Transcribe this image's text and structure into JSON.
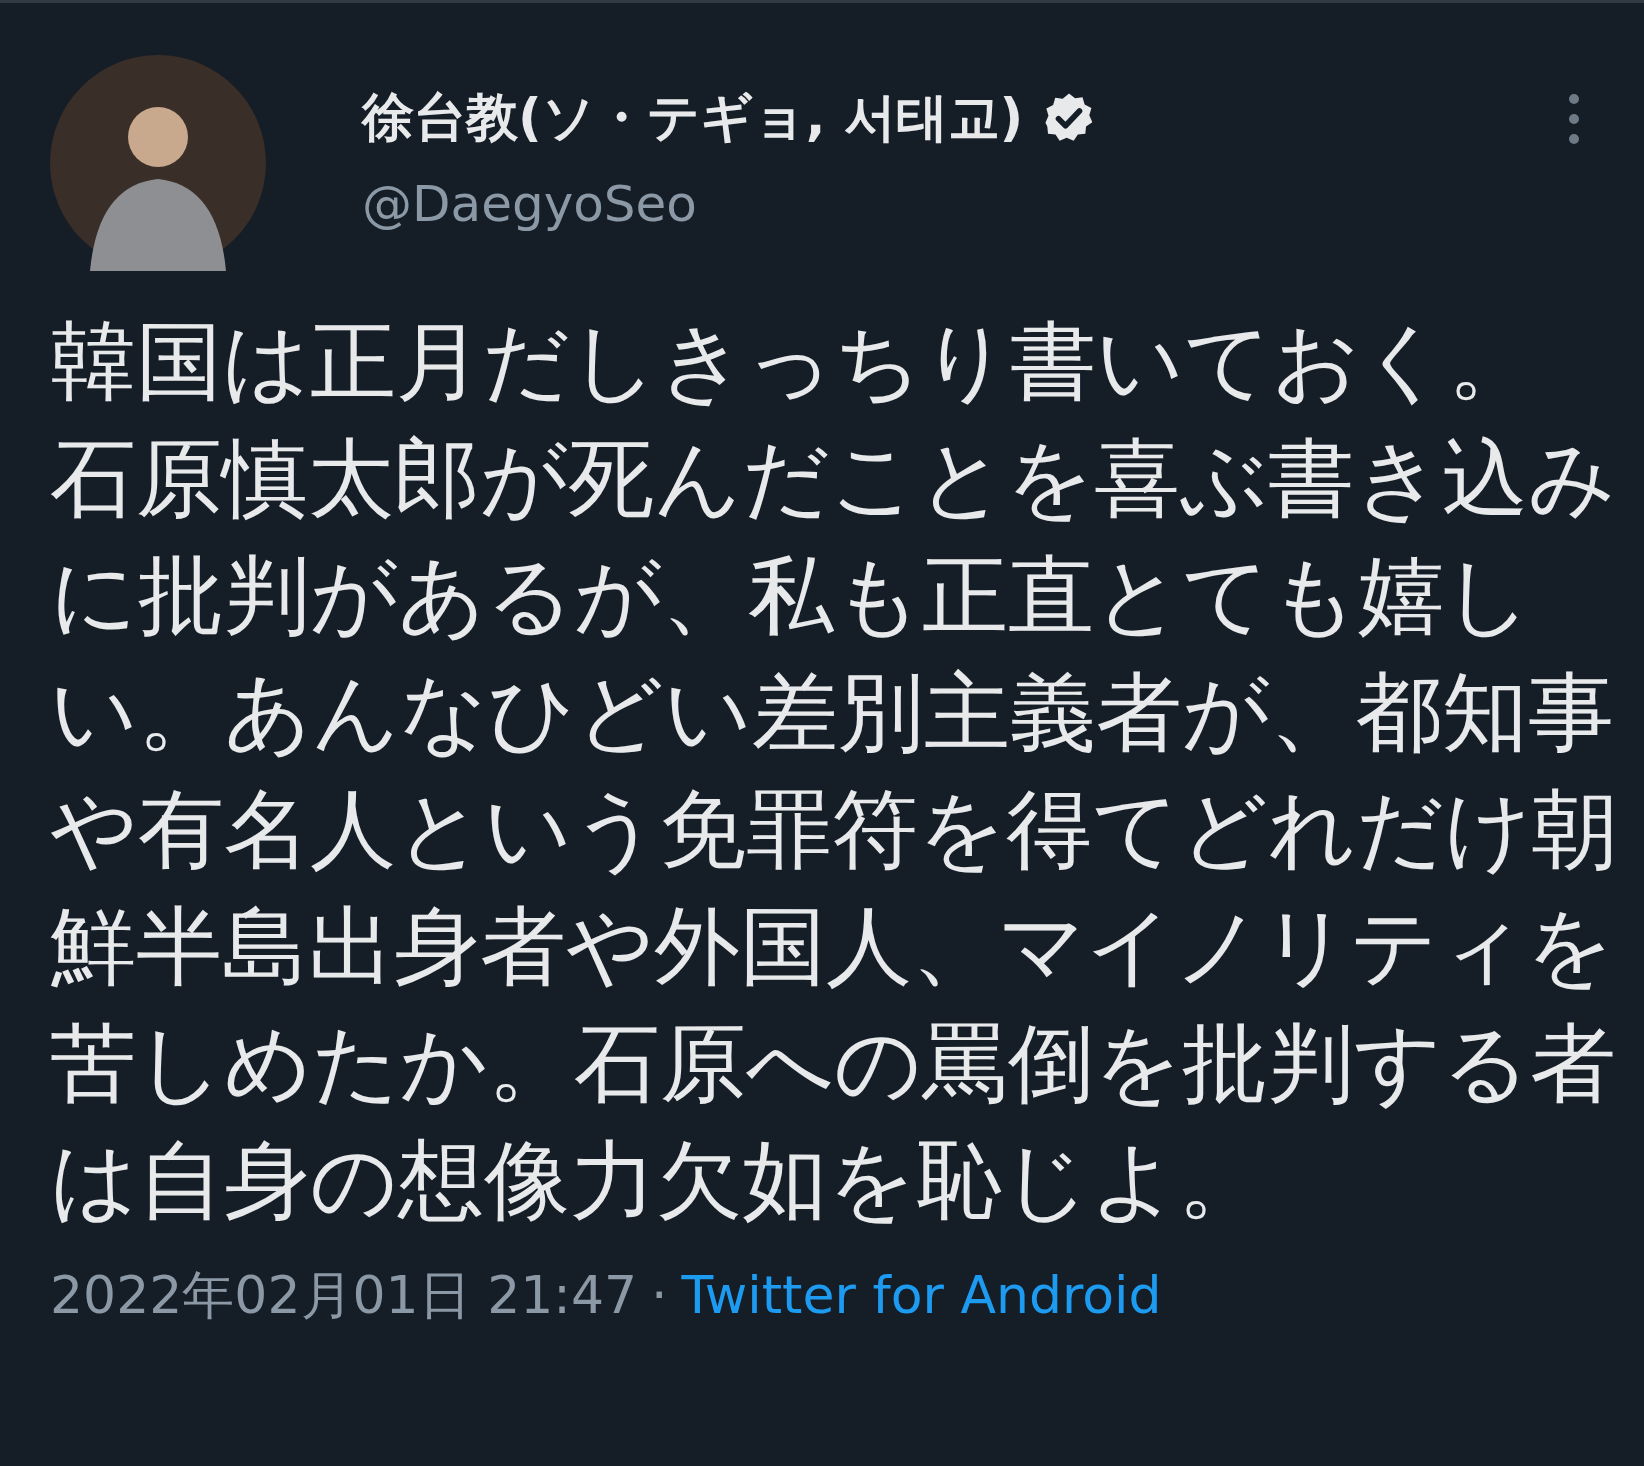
{
  "author": {
    "name": "徐台教(ソ・テギョ, 서태교)",
    "verified": true,
    "handle": "@DaegyoSeo"
  },
  "body": [
    "韓国は正月だしきっちり書いておく。",
    "石原慎太郎が死んだことを喜ぶ書き込みに批判があるが、私も正直とても嬉しい。あんなひどい差別主義者が、都知事や有名人という免罪符を得てどれだけ朝鮮半島出身者や外国人、マイノリティを苦しめたか。石原への罵倒を批判する者は自身の想像力欠如を恥じよ。"
  ],
  "footer": {
    "timestamp": "2022年02月01日 21:47",
    "separator": "·",
    "source": "Twitter for Android"
  }
}
